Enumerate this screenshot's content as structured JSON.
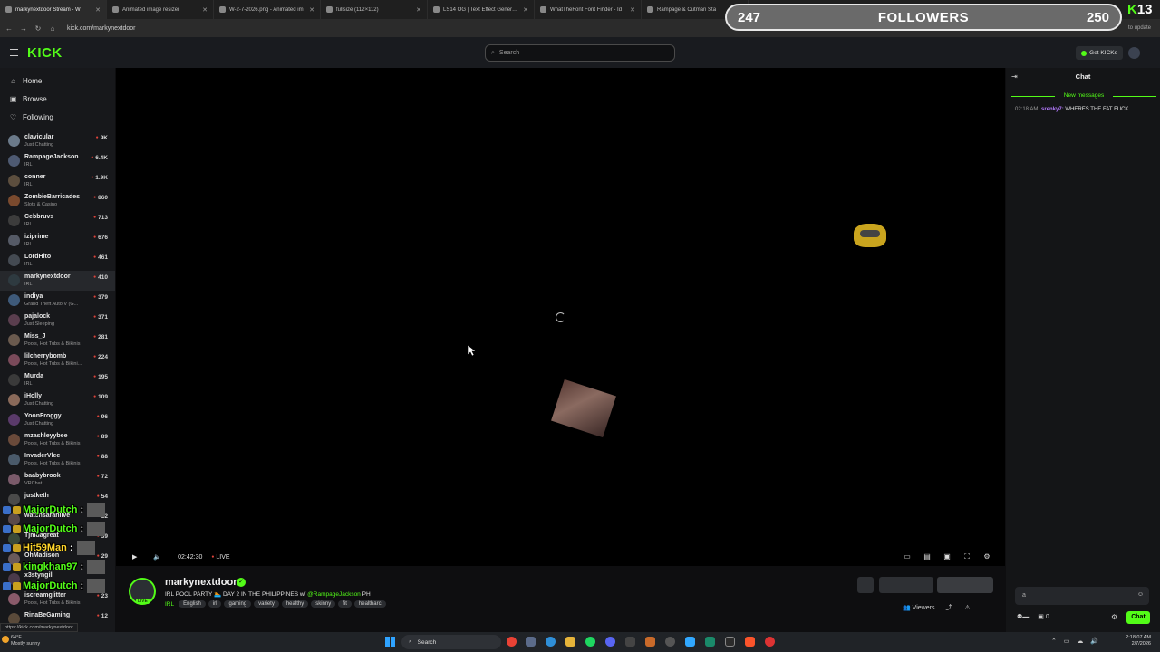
{
  "browser": {
    "tabs": [
      {
        "title": "markynextdoor Stream - W",
        "active": true
      },
      {
        "title": "Animated image resizer",
        "active": false
      },
      {
        "title": "W-2-7-2026.png - Animated im",
        "active": false
      },
      {
        "title": "fullsize (112×112)",
        "active": false
      },
      {
        "title": "LS14 OG | Text Effect Generator",
        "active": false
      },
      {
        "title": "WhatTheFont Font Finder - Id",
        "active": false
      },
      {
        "title": "Rampage & Cutman Sta",
        "active": false
      }
    ],
    "url": "kick.com/markynextdoor",
    "update_hint": "to update",
    "status_url": "https://kick.com/markynextdoor"
  },
  "header": {
    "logo": "KICK",
    "search_placeholder": "Search",
    "get_kicks": "Get KICKs"
  },
  "overlay": {
    "left_count": "247",
    "label": "FOLLOWERS",
    "right_count": "250",
    "badge_k": "K",
    "badge_num": "13"
  },
  "sidebar": {
    "nav": [
      {
        "label": "Home",
        "icon": "home-icon"
      },
      {
        "label": "Browse",
        "icon": "browse-icon"
      },
      {
        "label": "Following",
        "icon": "heart-icon"
      }
    ],
    "channels": [
      {
        "name": "clavicular",
        "category": "Just Chatting",
        "viewers": "9K",
        "color": "#6b7a8a"
      },
      {
        "name": "RampageJackson",
        "category": "IRL",
        "viewers": "6.4K",
        "color": "#4e5a72"
      },
      {
        "name": "conner",
        "category": "IRL",
        "viewers": "1.9K",
        "color": "#5c4e3e"
      },
      {
        "name": "ZombieBarricades",
        "category": "Slots & Casino",
        "viewers": "860",
        "color": "#7a4a2e"
      },
      {
        "name": "Cebbruvs",
        "category": "IRL",
        "viewers": "713",
        "color": "#3c3c3c"
      },
      {
        "name": "iziprime",
        "category": "IRL",
        "viewers": "676",
        "color": "#555a66"
      },
      {
        "name": "LordHito",
        "category": "IRL",
        "viewers": "461",
        "color": "#444a52"
      },
      {
        "name": "markynextdoor",
        "category": "IRL",
        "viewers": "410",
        "color": "#2e3a40",
        "selected": true
      },
      {
        "name": "indiya",
        "category": "Grand Theft Auto V (G...",
        "viewers": "379",
        "color": "#3e5a7a"
      },
      {
        "name": "pajalock",
        "category": "Just Sleeping",
        "viewers": "371",
        "color": "#5a3e4e"
      },
      {
        "name": "Miss_J",
        "category": "Pools, Hot Tubs & Bikinis",
        "viewers": "281",
        "color": "#6a5a4e"
      },
      {
        "name": "lilcherrybomb",
        "category": "Pools, Hot Tubs & Bikini...",
        "viewers": "224",
        "color": "#7a4a5a"
      },
      {
        "name": "Murda",
        "category": "IRL",
        "viewers": "195",
        "color": "#3a3a3a"
      },
      {
        "name": "iHolly",
        "category": "Just Chatting",
        "viewers": "109",
        "color": "#8a6a5a"
      },
      {
        "name": "YoonFroggy",
        "category": "Just Chatting",
        "viewers": "96",
        "color": "#5a3a6a"
      },
      {
        "name": "mzashleyybee",
        "category": "Pools, Hot Tubs & Bikinis",
        "viewers": "89",
        "color": "#6a4a3a"
      },
      {
        "name": "InvaderVlee",
        "category": "Pools, Hot Tubs & Bikinis",
        "viewers": "88",
        "color": "#4a5a6a"
      },
      {
        "name": "baabybrook",
        "category": "VRChat",
        "viewers": "72",
        "color": "#7a5a6a"
      },
      {
        "name": "justketh",
        "category": "",
        "viewers": "54",
        "color": "#4a4a4a"
      },
      {
        "name": "watchsarahlive",
        "category": "",
        "viewers": "52",
        "color": "#5a4a4a"
      },
      {
        "name": "Tjmdagreat",
        "category": "",
        "viewers": "39",
        "color": "#3a4a3a"
      },
      {
        "name": "OhMadison",
        "category": "",
        "viewers": "29",
        "color": "#6a5a5a"
      },
      {
        "name": "x3styngill",
        "category": "",
        "viewers": "",
        "color": "#4a3a4a"
      },
      {
        "name": "iscreamglitter",
        "category": "Pools, Hot Tubs & Bikinis",
        "viewers": "23",
        "color": "#8a5a6a"
      },
      {
        "name": "RinaBeGaming",
        "category": "",
        "viewers": "12",
        "color": "#5a4a3a"
      }
    ]
  },
  "chat_overlay": [
    {
      "user": "MajorDutch",
      "sep": ":",
      "color": "green",
      "pic": true
    },
    {
      "user": "MajorDutch",
      "sep": ":",
      "color": "green",
      "pic": true
    },
    {
      "user": "Hit59Man",
      "sep": ":",
      "color": "yellow",
      "pic": true
    },
    {
      "user": "kingkhan97",
      "sep": ":",
      "color": "green",
      "pic": true
    },
    {
      "user": "MajorDutch",
      "sep": ":",
      "color": "green",
      "pic": true
    }
  ],
  "player": {
    "time": "02:42:30",
    "live": "LIVE"
  },
  "stream": {
    "name": "markynextdoor",
    "title": "IRL POOL PARTY 🏊 DAY 2 IN THE PHILIPPINES w/ ",
    "mention": "@RampageJackson",
    "title_suffix": "PH",
    "category": "IRL",
    "tags": [
      "English",
      "irl",
      "gaming",
      "variety",
      "healthy",
      "skinny",
      "fit",
      "healtharc"
    ],
    "live_tag": "LIVE",
    "viewers_label": "Viewers"
  },
  "chat": {
    "title": "Chat",
    "new_messages": "New messages",
    "messages": [
      {
        "time": "02:18 AM",
        "user": "srenky7:",
        "text": "WHERES THE FAT FUCK"
      }
    ],
    "input_value": "a",
    "send": "Chat",
    "footer_count": "0"
  },
  "taskbar": {
    "temp": "64°F",
    "weather": "Mostly sunny",
    "search": "Search",
    "time": "2:18:07 AM",
    "date": "2/7/2026"
  },
  "colors": {
    "kick_green": "#53fc18",
    "live_red": "#e0433a"
  }
}
